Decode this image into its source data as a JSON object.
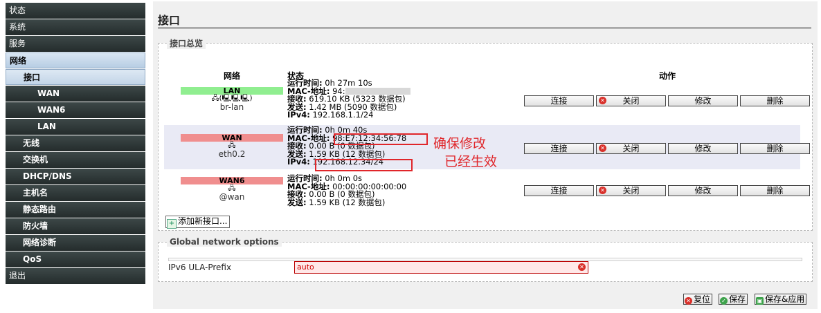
{
  "sidebar": {
    "items": [
      {
        "label": "状态"
      },
      {
        "label": "系统"
      },
      {
        "label": "服务"
      },
      {
        "label": "网络"
      },
      {
        "label": "接口"
      },
      {
        "label": "WAN"
      },
      {
        "label": "WAN6"
      },
      {
        "label": "LAN"
      },
      {
        "label": "无线"
      },
      {
        "label": "交换机"
      },
      {
        "label": "DHCP/DNS"
      },
      {
        "label": "主机名"
      },
      {
        "label": "静态路由"
      },
      {
        "label": "防火墙"
      },
      {
        "label": "网络诊断"
      },
      {
        "label": "QoS"
      },
      {
        "label": "退出"
      }
    ]
  },
  "main": {
    "title": "接口",
    "overview_legend": "接口总览",
    "headers": {
      "network": "网络",
      "status": "状态",
      "actions": "动作"
    },
    "interfaces": [
      {
        "name": "LAN",
        "color": "#90ee90",
        "icons": "🖧(🖳🖳🖳)",
        "device": "br-lan",
        "uptime_label": "运行时间:",
        "uptime": "0h 27m 10s",
        "mac_label": "MAC-地址:",
        "mac": "94:",
        "rx_label": "接收:",
        "rx": "619.10 KB (5323 数据包)",
        "tx_label": "发送:",
        "tx": "1.42 MB (5090 数据包)",
        "ipv4_label": "IPv4:",
        "ipv4": "192.168.1.1/24"
      },
      {
        "name": "WAN",
        "color": "#f08e8e",
        "icons": "🖧",
        "device": "eth0.2",
        "uptime_label": "运行时间:",
        "uptime": "0h 0m 40s",
        "mac_label": "MAC-地址:",
        "mac": "98:E7:12:34:56:78",
        "rx_label": "接收:",
        "rx": "0.00 B (0 数据包)",
        "tx_label": "发送:",
        "tx": "1.59 KB (12 数据包)",
        "ipv4_label": "IPv4:",
        "ipv4": "192.168.12.34/24"
      },
      {
        "name": "WAN6",
        "color": "#f08e8e",
        "icons": "🖧",
        "device": "@wan",
        "uptime_label": "运行时间:",
        "uptime": "0h 0m 0s",
        "mac_label": "MAC-地址:",
        "mac": "00:00:00:00:00:00",
        "rx_label": "接收:",
        "rx": "0.00 B (0 数据包)",
        "tx_label": "发送:",
        "tx": "1.59 KB (12 数据包)"
      }
    ],
    "buttons": {
      "connect": "连接",
      "close": "关闭",
      "edit": "修改",
      "delete": "删除"
    },
    "add_interface": "添加新接口...",
    "annotation_line1": "确保修改",
    "annotation_line2": "已经生效",
    "global_legend": "Global network options",
    "ula_label": "IPv6 ULA-Prefix",
    "ula_value": "auto"
  },
  "footer": {
    "reset": "复位",
    "save": "保存",
    "save_apply": "保存&应用"
  }
}
